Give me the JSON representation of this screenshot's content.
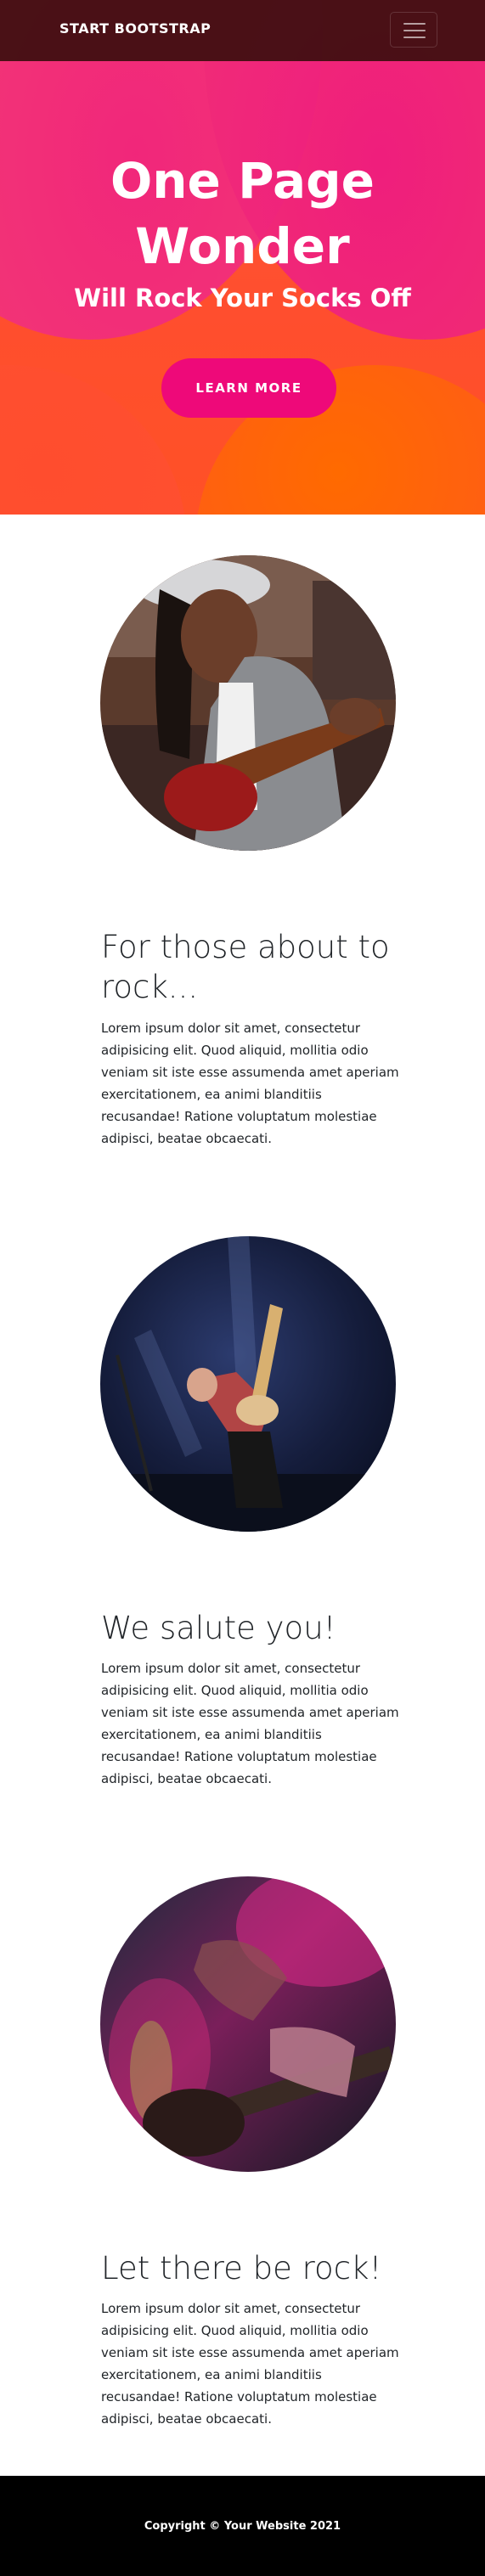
{
  "navbar": {
    "brand": "Start Bootstrap",
    "toggle_icon": "hamburger-icon"
  },
  "hero": {
    "title_line1": "One Page",
    "title_line2": "Wonder",
    "subtitle": "Will Rock Your Socks Off",
    "button_label": "Learn More",
    "colors": {
      "gradient_orange": "#ff5c3a",
      "magenta": "#ee0979",
      "orange": "#ff6a00"
    }
  },
  "sections": [
    {
      "title": "For those about to rock...",
      "text": "Lorem ipsum dolor sit amet, consectetur adipisicing elit. Quod aliquid, mollitia odio veniam sit iste esse assumenda amet aperiam exercitationem, ea animi blanditiis recusandae! Ratione voluptatum molestiae adipisci, beatae obcaecati.",
      "image": "woman-playing-guitar-photo"
    },
    {
      "title": "We salute you!",
      "text": "Lorem ipsum dolor sit amet, consectetur adipisicing elit. Quod aliquid, mollitia odio veniam sit iste esse assumenda amet aperiam exercitationem, ea animi blanditiis recusandae! Ratione voluptatum molestiae adipisci, beatae obcaecati.",
      "image": "guitarist-on-stage-photo"
    },
    {
      "title": "Let there be rock!",
      "text": "Lorem ipsum dolor sit amet, consectetur adipisicing elit. Quod aliquid, mollitia odio veniam sit iste esse assumenda amet aperiam exercitationem, ea animi blanditiis recusandae! Ratione voluptatum molestiae adipisci, beatae obcaecati.",
      "image": "guitar-closeup-photo"
    }
  ],
  "footer": {
    "copyright": "Copyright © Your Website 2021"
  }
}
